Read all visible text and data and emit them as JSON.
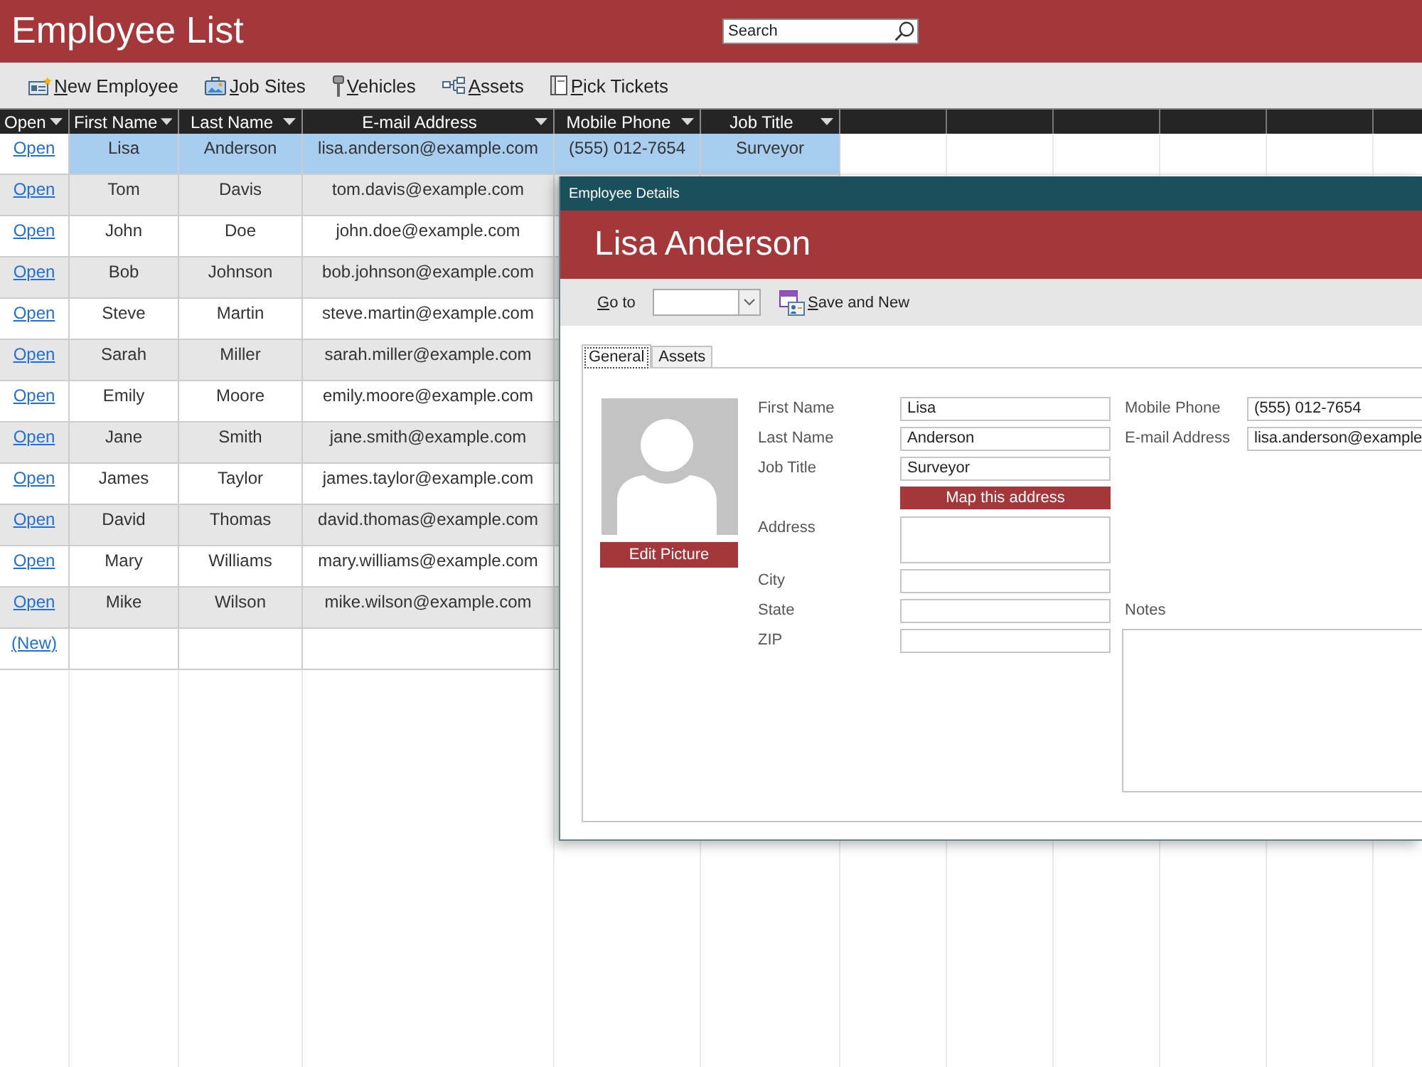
{
  "header": {
    "title": "Employee List",
    "search": {
      "placeholder": "Search"
    }
  },
  "toolbar": [
    {
      "label": "New Employee"
    },
    {
      "label": "Job Sites"
    },
    {
      "label": "Vehicles"
    },
    {
      "label": "Assets"
    },
    {
      "label": "Pick Tickets"
    }
  ],
  "grid": {
    "columns": [
      {
        "label": "Open"
      },
      {
        "label": "First Name"
      },
      {
        "label": "Last Name"
      },
      {
        "label": "E-mail Address"
      },
      {
        "label": "Mobile Phone"
      },
      {
        "label": "Job Title"
      }
    ],
    "rows": [
      {
        "selected": true,
        "cells": [
          "Open",
          "Lisa",
          "Anderson",
          "lisa.anderson@example.com",
          "(555) 012-7654",
          "Surveyor"
        ]
      },
      {
        "selected": false,
        "cells": [
          "Open",
          "Tom",
          "Davis",
          "tom.davis@example.com"
        ]
      },
      {
        "selected": false,
        "cells": [
          "Open",
          "John",
          "Doe",
          "john.doe@example.com"
        ]
      },
      {
        "selected": false,
        "cells": [
          "Open",
          "Bob",
          "Johnson",
          "bob.johnson@example.com"
        ]
      },
      {
        "selected": false,
        "cells": [
          "Open",
          "Steve",
          "Martin",
          "steve.martin@example.com"
        ]
      },
      {
        "selected": false,
        "cells": [
          "Open",
          "Sarah",
          "Miller",
          "sarah.miller@example.com"
        ]
      },
      {
        "selected": false,
        "cells": [
          "Open",
          "Emily",
          "Moore",
          "emily.moore@example.com"
        ]
      },
      {
        "selected": false,
        "cells": [
          "Open",
          "Jane",
          "Smith",
          "jane.smith@example.com"
        ]
      },
      {
        "selected": false,
        "cells": [
          "Open",
          "James",
          "Taylor",
          "james.taylor@example.com"
        ]
      },
      {
        "selected": false,
        "cells": [
          "Open",
          "David",
          "Thomas",
          "david.thomas@example.com"
        ]
      },
      {
        "selected": false,
        "cells": [
          "Open",
          "Mary",
          "Williams",
          "mary.williams@example.com"
        ]
      },
      {
        "selected": false,
        "cells": [
          "Open",
          "Mike",
          "Wilson",
          "mike.wilson@example.com"
        ]
      }
    ],
    "new_row": {
      "link": "(New)"
    }
  },
  "dialog": {
    "title": "Employee Details",
    "heading": "Lisa Anderson",
    "goto": {
      "label": "Go to"
    },
    "save_button": {
      "label": "Save and New"
    },
    "tabs": [
      {
        "label": "General",
        "selected": true
      },
      {
        "label": "Assets",
        "selected": false
      }
    ],
    "picture_button": {
      "label": "Edit Picture"
    },
    "fields": [
      {
        "kind": "text",
        "label": "First Name",
        "value": "Lisa"
      },
      {
        "kind": "text",
        "label": "Last Name",
        "value": "Anderson"
      },
      {
        "kind": "text",
        "label": "Job Title",
        "value": "Surveyor"
      },
      {
        "kind": "button",
        "label": "Map this address"
      },
      {
        "kind": "multiline",
        "label": "Address"
      },
      {
        "kind": "text",
        "label": "City"
      },
      {
        "kind": "text",
        "label": "State"
      },
      {
        "kind": "text",
        "label": "ZIP"
      }
    ],
    "side_fields": [
      {
        "label": "Mobile Phone",
        "value": "(555) 012-7654"
      },
      {
        "label": "E-mail Address",
        "value": "lisa.anderson@example"
      }
    ],
    "notes": {
      "label": "Notes"
    }
  }
}
